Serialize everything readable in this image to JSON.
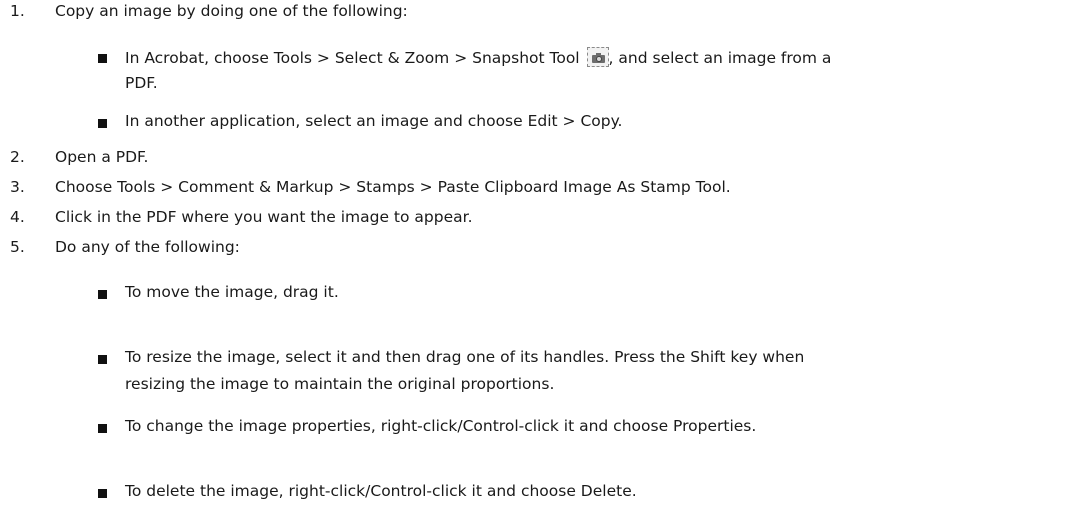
{
  "steps": [
    {
      "number": "1.",
      "text": "Copy an image by doing one of the following:",
      "substeps": [
        {
          "text_before_icon": "In Acrobat, choose Tools > Select & Zoom > Snapshot Tool",
          "icon": "snapshot-camera-icon",
          "text_after_icon": ", and select an image from a",
          "text_line2": "PDF."
        },
        {
          "text": "In another application, select an image and choose Edit > Copy."
        }
      ]
    },
    {
      "number": "2.",
      "text": "Open a PDF."
    },
    {
      "number": "3.",
      "text": "Choose Tools > Comment & Markup > Stamps > Paste Clipboard Image As Stamp Tool."
    },
    {
      "number": "4.",
      "text": "Click in the PDF where you want the image to appear."
    },
    {
      "number": "5.",
      "text": "Do any of the following:",
      "substeps": [
        {
          "text": "To move the image, drag it."
        },
        {
          "text": "To resize the image, select it and then drag one of its handles. Press the Shift key when",
          "text_line2": "resizing the image to maintain the original proportions."
        },
        {
          "text": "To change the image properties, right-click/Control-click it and choose Properties."
        },
        {
          "text": "To delete the image, right-click/Control-click it and choose Delete."
        }
      ]
    }
  ]
}
